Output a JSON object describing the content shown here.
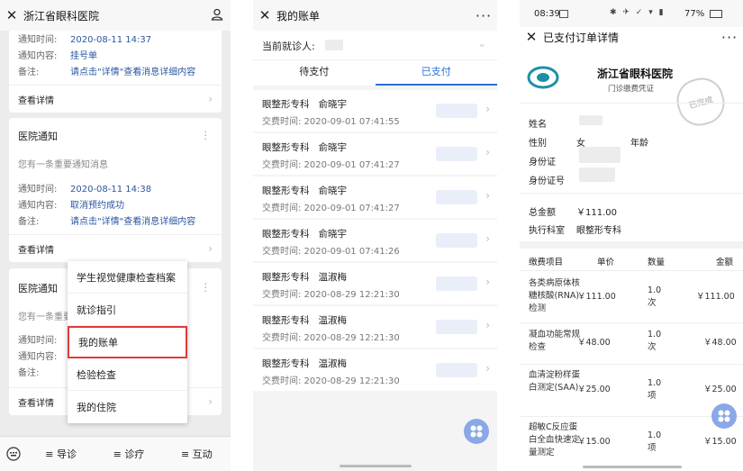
{
  "p1": {
    "header_title": "浙江省眼科医院",
    "card0": {
      "rows": [
        {
          "k": "通知时间:",
          "v": "2020-08-11 14:37"
        },
        {
          "k": "通知内容:",
          "v": "挂号单"
        },
        {
          "k": "备注:",
          "v": "请点击\"详情\"查看消息详细内容"
        }
      ],
      "link": "查看详情"
    },
    "card1": {
      "title": "医院通知",
      "sub": "您有一条重要通知消息",
      "rows": [
        {
          "k": "通知时间:",
          "v": "2020-08-11 14:38"
        },
        {
          "k": "通知内容:",
          "v": "取消预约成功"
        },
        {
          "k": "备注:",
          "v": "请点击\"详情\"查看消息详细内容"
        }
      ],
      "link": "查看详情"
    },
    "card2": {
      "title": "医院通知",
      "sub": "您有一条重要",
      "rows": [
        {
          "k": "通知时间:"
        },
        {
          "k": "通知内容:"
        },
        {
          "k": "备注:"
        }
      ],
      "link": "查看详情"
    },
    "menu": [
      "学生视觉健康检查档案",
      "就诊指引",
      "我的账单",
      "检验检查",
      "我的住院"
    ],
    "tabbar": [
      "≡ 导诊",
      "≡ 诊疗",
      "≡ 互动"
    ]
  },
  "p2": {
    "title": "我的账单",
    "patient_label": "当前就诊人:",
    "tabs": [
      "待支付",
      "已支付"
    ],
    "active_tab": 1,
    "bills": [
      {
        "dept": "眼整形专科",
        "doctor": "俞晓宇",
        "time": "交费时间: 2020-09-01 07:41:55"
      },
      {
        "dept": "眼整形专科",
        "doctor": "俞晓宇",
        "time": "交费时间: 2020-09-01 07:41:27"
      },
      {
        "dept": "眼整形专科",
        "doctor": "俞晓宇",
        "time": "交费时间: 2020-09-01 07:41:27"
      },
      {
        "dept": "眼整形专科",
        "doctor": "俞晓宇",
        "time": "交费时间: 2020-09-01 07:41:26"
      },
      {
        "dept": "眼整形专科",
        "doctor": "温淑梅",
        "time": "交费时间: 2020-08-29 12:21:30"
      },
      {
        "dept": "眼整形专科",
        "doctor": "温淑梅",
        "time": "交费时间: 2020-08-29 12:21:30"
      },
      {
        "dept": "眼整形专科",
        "doctor": "温淑梅",
        "time": "交费时间: 2020-08-29 12:21:30"
      }
    ],
    "accent": "#2a6fdb"
  },
  "p3": {
    "status_time": "08:39",
    "battery": "77%",
    "title": "已支付订单详情",
    "hospital": "浙江省眼科医院",
    "voucher": "门诊缴费凭证",
    "stamp": "已完成",
    "info": {
      "name": "姓名",
      "gender": "性别",
      "gender_value": "女",
      "age": "年龄",
      "id_card": "身份证",
      "id_card_no": "身份证号"
    },
    "total_label": "总金额",
    "total_value": "￥111.00",
    "dept_label": "执行科室",
    "dept_value": "眼整形专科",
    "table_headers": [
      "缴费项目",
      "单价",
      "数量",
      "金额"
    ],
    "items": [
      {
        "name": "各类病原体核糖核酸(RNA)检测",
        "price": "￥111.00",
        "qty": "1.0次",
        "amount": "￥111.00"
      },
      {
        "name": "凝血功能常规检查",
        "price": "￥48.00",
        "qty": "1.0次",
        "amount": "￥48.00"
      },
      {
        "name": "血清淀粉样蛋白测定(SAA)",
        "price": "￥25.00",
        "qty": "1.0项",
        "amount": "￥25.00"
      },
      {
        "name": "超敏C反应蛋白全血快速定量测定",
        "price": "￥15.00",
        "qty": "1.0项",
        "amount": "￥15.00"
      }
    ]
  }
}
